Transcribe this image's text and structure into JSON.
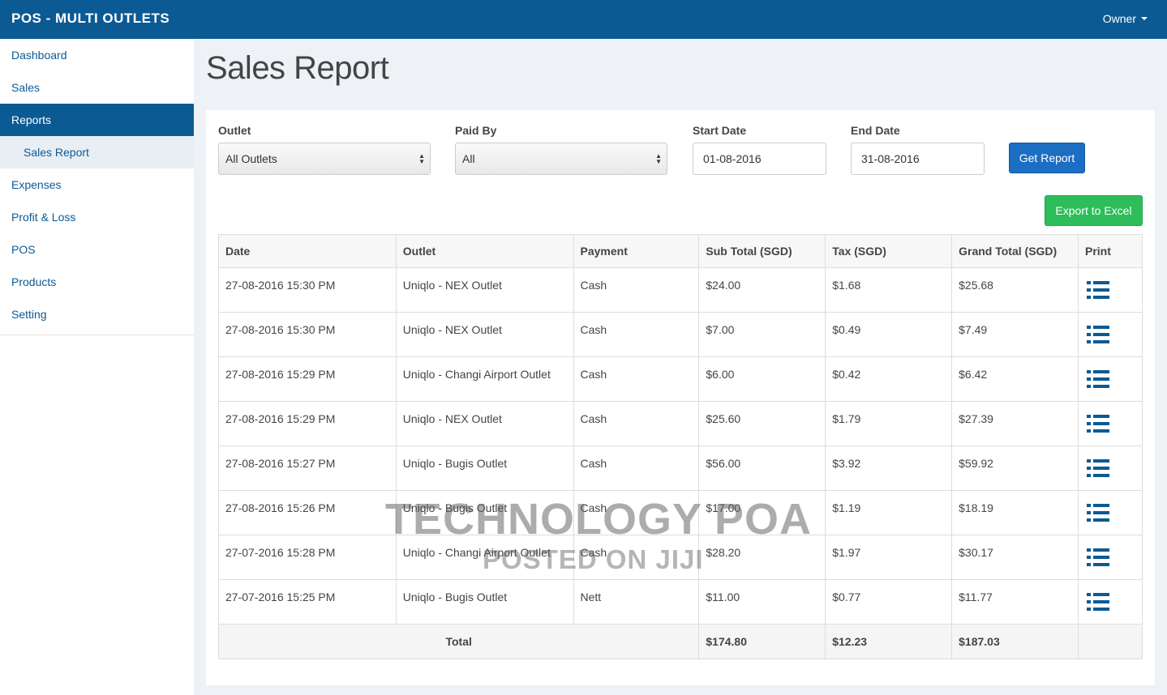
{
  "app": {
    "title": "POS - MULTI OUTLETS",
    "user_menu": "Owner"
  },
  "sidebar": {
    "items": [
      {
        "label": "Dashboard"
      },
      {
        "label": "Sales"
      },
      {
        "label": "Reports"
      },
      {
        "label": "Sales Report"
      },
      {
        "label": "Expenses"
      },
      {
        "label": "Profit & Loss"
      },
      {
        "label": "POS"
      },
      {
        "label": "Products"
      },
      {
        "label": "Setting"
      }
    ]
  },
  "page": {
    "title": "Sales Report"
  },
  "filters": {
    "outlet": {
      "label": "Outlet",
      "value": "All Outlets"
    },
    "paid_by": {
      "label": "Paid By",
      "value": "All"
    },
    "start_date": {
      "label": "Start Date",
      "value": "01-08-2016"
    },
    "end_date": {
      "label": "End Date",
      "value": "31-08-2016"
    },
    "get_report_label": "Get Report",
    "export_label": "Export to Excel"
  },
  "table": {
    "headers": [
      "Date",
      "Outlet",
      "Payment",
      "Sub Total (SGD)",
      "Tax (SGD)",
      "Grand Total (SGD)",
      "Print"
    ],
    "rows": [
      [
        "27-08-2016 15:30 PM",
        "Uniqlo - NEX Outlet",
        "Cash",
        "$24.00",
        "$1.68",
        "$25.68"
      ],
      [
        "27-08-2016 15:30 PM",
        "Uniqlo - NEX Outlet",
        "Cash",
        "$7.00",
        "$0.49",
        "$7.49"
      ],
      [
        "27-08-2016 15:29 PM",
        "Uniqlo - Changi Airport Outlet",
        "Cash",
        "$6.00",
        "$0.42",
        "$6.42"
      ],
      [
        "27-08-2016 15:29 PM",
        "Uniqlo - NEX Outlet",
        "Cash",
        "$25.60",
        "$1.79",
        "$27.39"
      ],
      [
        "27-08-2016 15:27 PM",
        "Uniqlo - Bugis Outlet",
        "Cash",
        "$56.00",
        "$3.92",
        "$59.92"
      ],
      [
        "27-08-2016 15:26 PM",
        "Uniqlo - Bugis Outlet",
        "Cash",
        "$17.00",
        "$1.19",
        "$18.19"
      ],
      [
        "27-07-2016 15:28 PM",
        "Uniqlo - Changi Airport Outlet",
        "Cash",
        "$28.20",
        "$1.97",
        "$30.17"
      ],
      [
        "27-07-2016 15:25 PM",
        "Uniqlo - Bugis Outlet",
        "Nett",
        "$11.00",
        "$0.77",
        "$11.77"
      ]
    ],
    "total": {
      "label": "Total",
      "sub_total": "$174.80",
      "tax": "$12.23",
      "grand_total": "$187.03"
    }
  },
  "watermark": {
    "line1": "TECHNOLOGY POA",
    "line2": "POSTED ON JIJI"
  },
  "icons": {
    "print": "list-icon",
    "user_menu": "caret-down-icon"
  },
  "colors": {
    "brand": "#0c5a94",
    "primary_button": "#1b6ec2",
    "success_button": "#2dbd5a"
  }
}
